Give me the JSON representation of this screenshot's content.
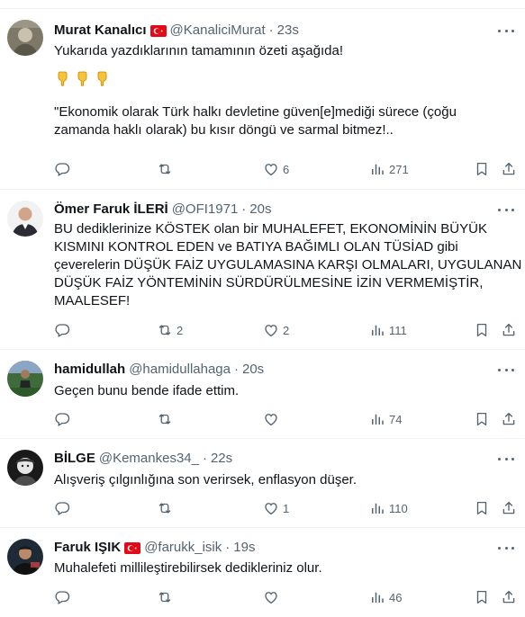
{
  "colors": {
    "text": "#0f1419",
    "secondary": "#536471",
    "border": "#eff3f4"
  },
  "tweets": [
    {
      "name": "Murat Kanalıcı",
      "flag": "turkish-flag",
      "handle": "@KanaliciMurat",
      "sep": "·",
      "time": "23s",
      "lines": [
        "Yukarıda yazdıklarının tamamının özeti aşağıda!",
        "\"Ekonomik olarak Türk halkı devletine güven[e]mediği sürece (çoğu",
        "zamanda haklı olarak) bu kısır döngü ve sarmal bitmez!.."
      ],
      "emojis": [
        "backhand-index-pointing-down",
        "backhand-index-pointing-down",
        "backhand-index-pointing-down"
      ],
      "reply_count": "",
      "retweet_count": "",
      "like_count": "6",
      "view_count": "271"
    },
    {
      "name": "Ömer Faruk İLERİ",
      "handle": "@OFI1971",
      "sep": "·",
      "time": "20s",
      "lines": [
        "BU dediklerinize KÖSTEK olan bir MUHALEFET, EKONOMİNİN BÜYÜK",
        "KISMINI KONTROL EDEN ve BATIYA BAĞIMLI OLAN TÜSİAD gibi",
        "çeverelerin DÜŞÜK FAİZ UYGULAMASINA KARŞI OLMALARI, UYGULANAN",
        "DÜŞÜK FAİZ YÖNTEMİNİN SÜRDÜRÜLMESİNE İZİN VERMEMİŞTİR,",
        "MAALESEF!"
      ],
      "reply_count": "",
      "retweet_count": "2",
      "like_count": "2",
      "view_count": "111"
    },
    {
      "name": "hamidullah",
      "handle": "@hamidullahaga",
      "sep": "·",
      "time": "20s",
      "lines": [
        "Geçen bunu bende ifade ettim."
      ],
      "reply_count": "",
      "retweet_count": "",
      "like_count": "",
      "view_count": "74"
    },
    {
      "name": "BİLGE",
      "handle": "@Kemankes34_",
      "sep": "·",
      "time": "22s",
      "lines": [
        "Alışveriş çılgınlığına son verirsek, enflasyon düşer."
      ],
      "reply_count": "",
      "retweet_count": "",
      "like_count": "1",
      "view_count": "110"
    },
    {
      "name": "Faruk IŞIK",
      "flag": "turkish-flag",
      "handle": "@farukk_isik",
      "sep": "·",
      "time": "19s",
      "lines": [
        "Muhalefeti millileştirebilirsek dedikleriniz olur."
      ],
      "reply_count": "",
      "retweet_count": "",
      "like_count": "",
      "view_count": "46"
    }
  ]
}
